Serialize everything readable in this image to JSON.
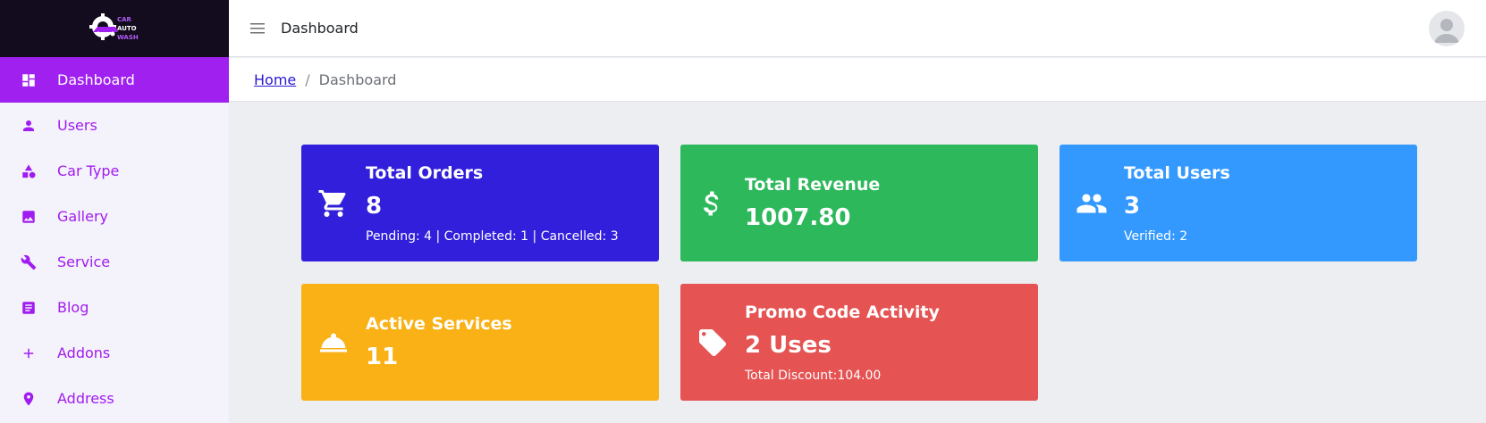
{
  "brand": {
    "logo_text": [
      "CAR",
      "AUTO",
      "WASH"
    ]
  },
  "sidebar": {
    "items": [
      {
        "label": "Dashboard",
        "icon": "dashboard-icon",
        "active": true
      },
      {
        "label": "Users",
        "icon": "user-icon"
      },
      {
        "label": "Car Type",
        "icon": "shapes-icon"
      },
      {
        "label": "Gallery",
        "icon": "image-icon"
      },
      {
        "label": "Service",
        "icon": "wrench-icon"
      },
      {
        "label": "Blog",
        "icon": "article-icon"
      },
      {
        "label": "Addons",
        "icon": "plus-icon"
      },
      {
        "label": "Address",
        "icon": "location-pin-icon"
      }
    ]
  },
  "topbar": {
    "title": "Dashboard"
  },
  "breadcrumb": {
    "home": "Home",
    "separator": "/",
    "current": "Dashboard"
  },
  "cards": {
    "total_orders": {
      "title": "Total Orders",
      "value": "8",
      "sub": "Pending: 4 | Completed: 1 | Cancelled: 3",
      "color": "#321fdb",
      "icon": "cart-icon"
    },
    "total_revenue": {
      "title": "Total Revenue",
      "value": "1007.80",
      "color": "#2eb85c",
      "icon": "dollar-icon"
    },
    "total_users": {
      "title": "Total Users",
      "value": "3",
      "sub": "Verified: 2",
      "color": "#3399ff",
      "icon": "users-icon"
    },
    "active_services": {
      "title": "Active Services",
      "value": "11",
      "color": "#f9b115",
      "icon": "service-bell-icon"
    },
    "promo_code": {
      "title": "Promo Code Activity",
      "value": "2 Uses",
      "sub": "Total Discount:104.00",
      "color": "#e55353",
      "icon": "tag-icon"
    }
  }
}
